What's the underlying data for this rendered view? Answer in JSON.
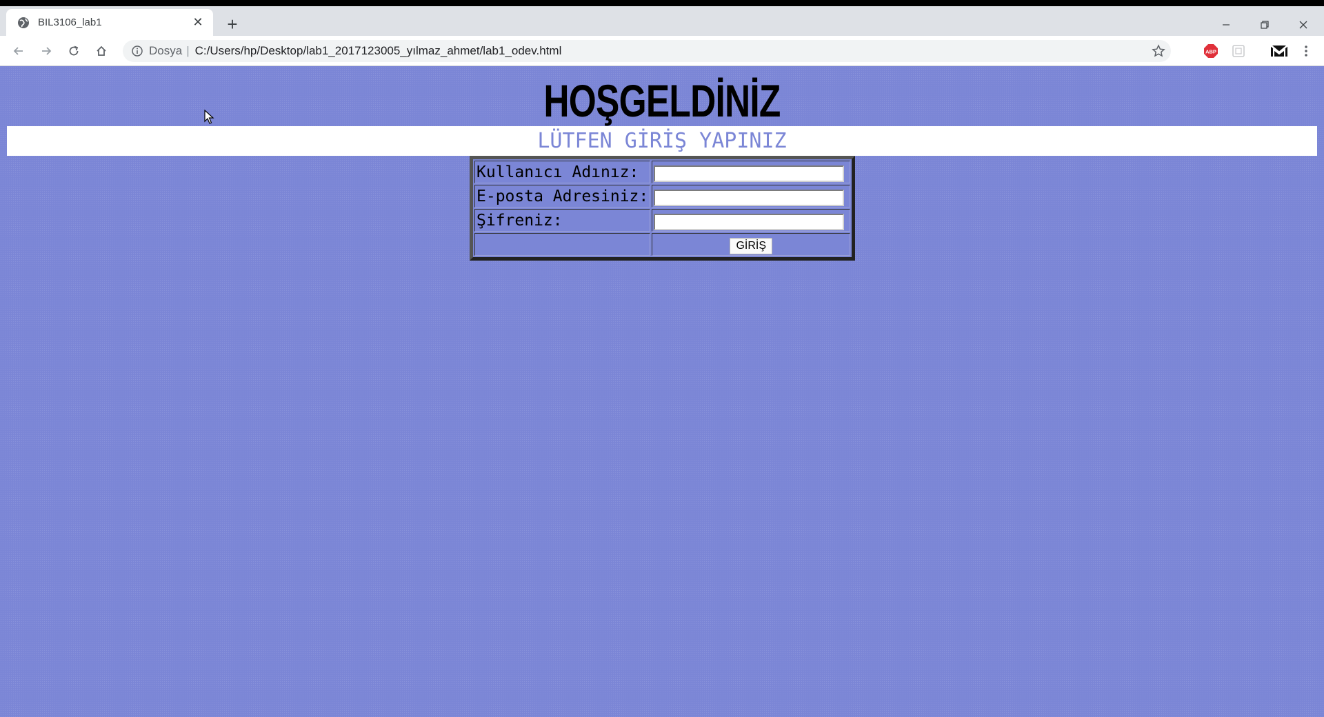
{
  "browser": {
    "tab": {
      "title": "BIL3106_lab1"
    },
    "address": {
      "scheme_label": "Dosya",
      "separator": "|",
      "url": "C:/Users/hp/Desktop/lab1_2017123005_yılmaz_ahmet/lab1_odev.html"
    },
    "extensions": [
      "abp-icon",
      "extension-placeholder-icon",
      "mailvelope-icon"
    ]
  },
  "page": {
    "heading": "HOŞGELDİNİZ",
    "subheading": "LÜTFEN GİRİŞ YAPINIZ",
    "form": {
      "username_label": "Kullanıcı Adınız:",
      "username_value": "",
      "email_label": "E-posta Adresiniz:",
      "email_value": "",
      "password_label": "Şifreniz:",
      "password_value": "",
      "submit_label": "GİRİŞ"
    }
  },
  "colors": {
    "page_background": "#7b86d6",
    "subheading_text": "#7b86d6",
    "abp_red": "#e0303a"
  }
}
